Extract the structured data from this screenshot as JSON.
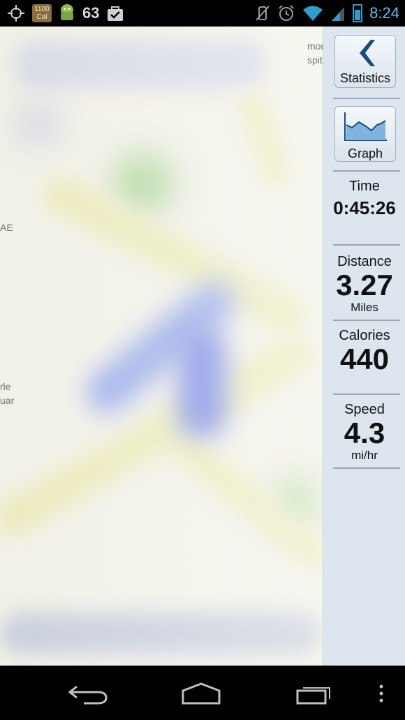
{
  "status_bar": {
    "calorie_badge": "1100\nCal",
    "notification_count": "63",
    "time": "8:24"
  },
  "map": {
    "edge_labels": [
      "mor",
      "spit",
      "AE",
      "rle",
      "uar"
    ]
  },
  "panel": {
    "statistics_button": "Statistics",
    "graph_button": "Graph",
    "time": {
      "label": "Time",
      "value": "0:45:26"
    },
    "distance": {
      "label": "Distance",
      "value": "3.27",
      "unit": "Miles"
    },
    "calories": {
      "label": "Calories",
      "value": "440"
    },
    "speed": {
      "label": "Speed",
      "value": "4.3",
      "unit": "mi/hr"
    }
  },
  "colors": {
    "panel_bg": "#dde6ef",
    "status_time": "#5dbfe6",
    "route": "#7b8fe0"
  }
}
